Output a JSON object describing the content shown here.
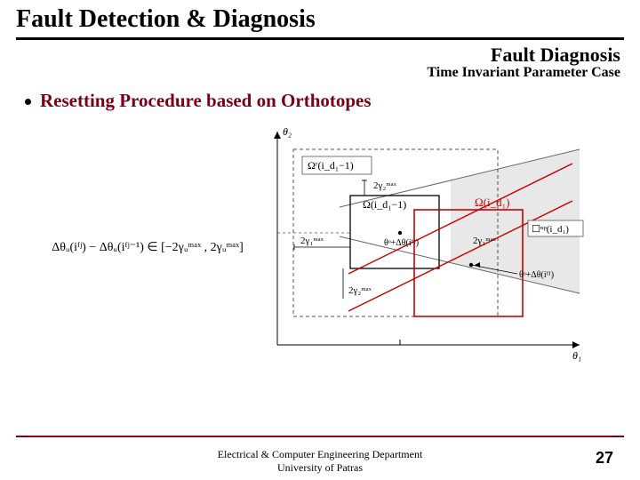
{
  "header": {
    "main_title": "Fault Detection & Diagnosis",
    "subtitle": "Fault Diagnosis",
    "subtitle2": "Time Invariant Parameter Case"
  },
  "bullet": {
    "text": "Resetting Procedure based on Orthotopes"
  },
  "formula": {
    "text": "Δθᵤ(iᶠʲ) − Δθᵤ(iᶠʲ⁻¹) ∈ [−2γᵤᵐᵃˣ , 2γᵤᵐᵃˣ]"
  },
  "figure": {
    "y_axis": "θ₂",
    "x_axis": "θ₁",
    "label_omega_r": "Ωʳ(i_d₁ − 1)",
    "label_omega": "Ω(i_d₁ − 1)",
    "label_omega_red": "Ω(i_d₁)",
    "label_box_np": "☐ⁿᵖ(i_d₁)",
    "label_2g2_top": "2γ₂ᵐᵃˣ",
    "label_2g1": "2γ₁ᵐᵃˣ",
    "label_2g1_right": "2γ₁ᵐᵃˣ",
    "label_2g2_bot": "2γ₂ᵐᵃˣ",
    "label_theta_o": "θᵒ + Δθ(iᶠ¹)",
    "label_theta_o2": "θᵒ + Δθ(iᶠ¹)"
  },
  "footer": {
    "line1": "Electrical & Computer Engineering Department",
    "line2": "University of Patras"
  },
  "page": "27"
}
